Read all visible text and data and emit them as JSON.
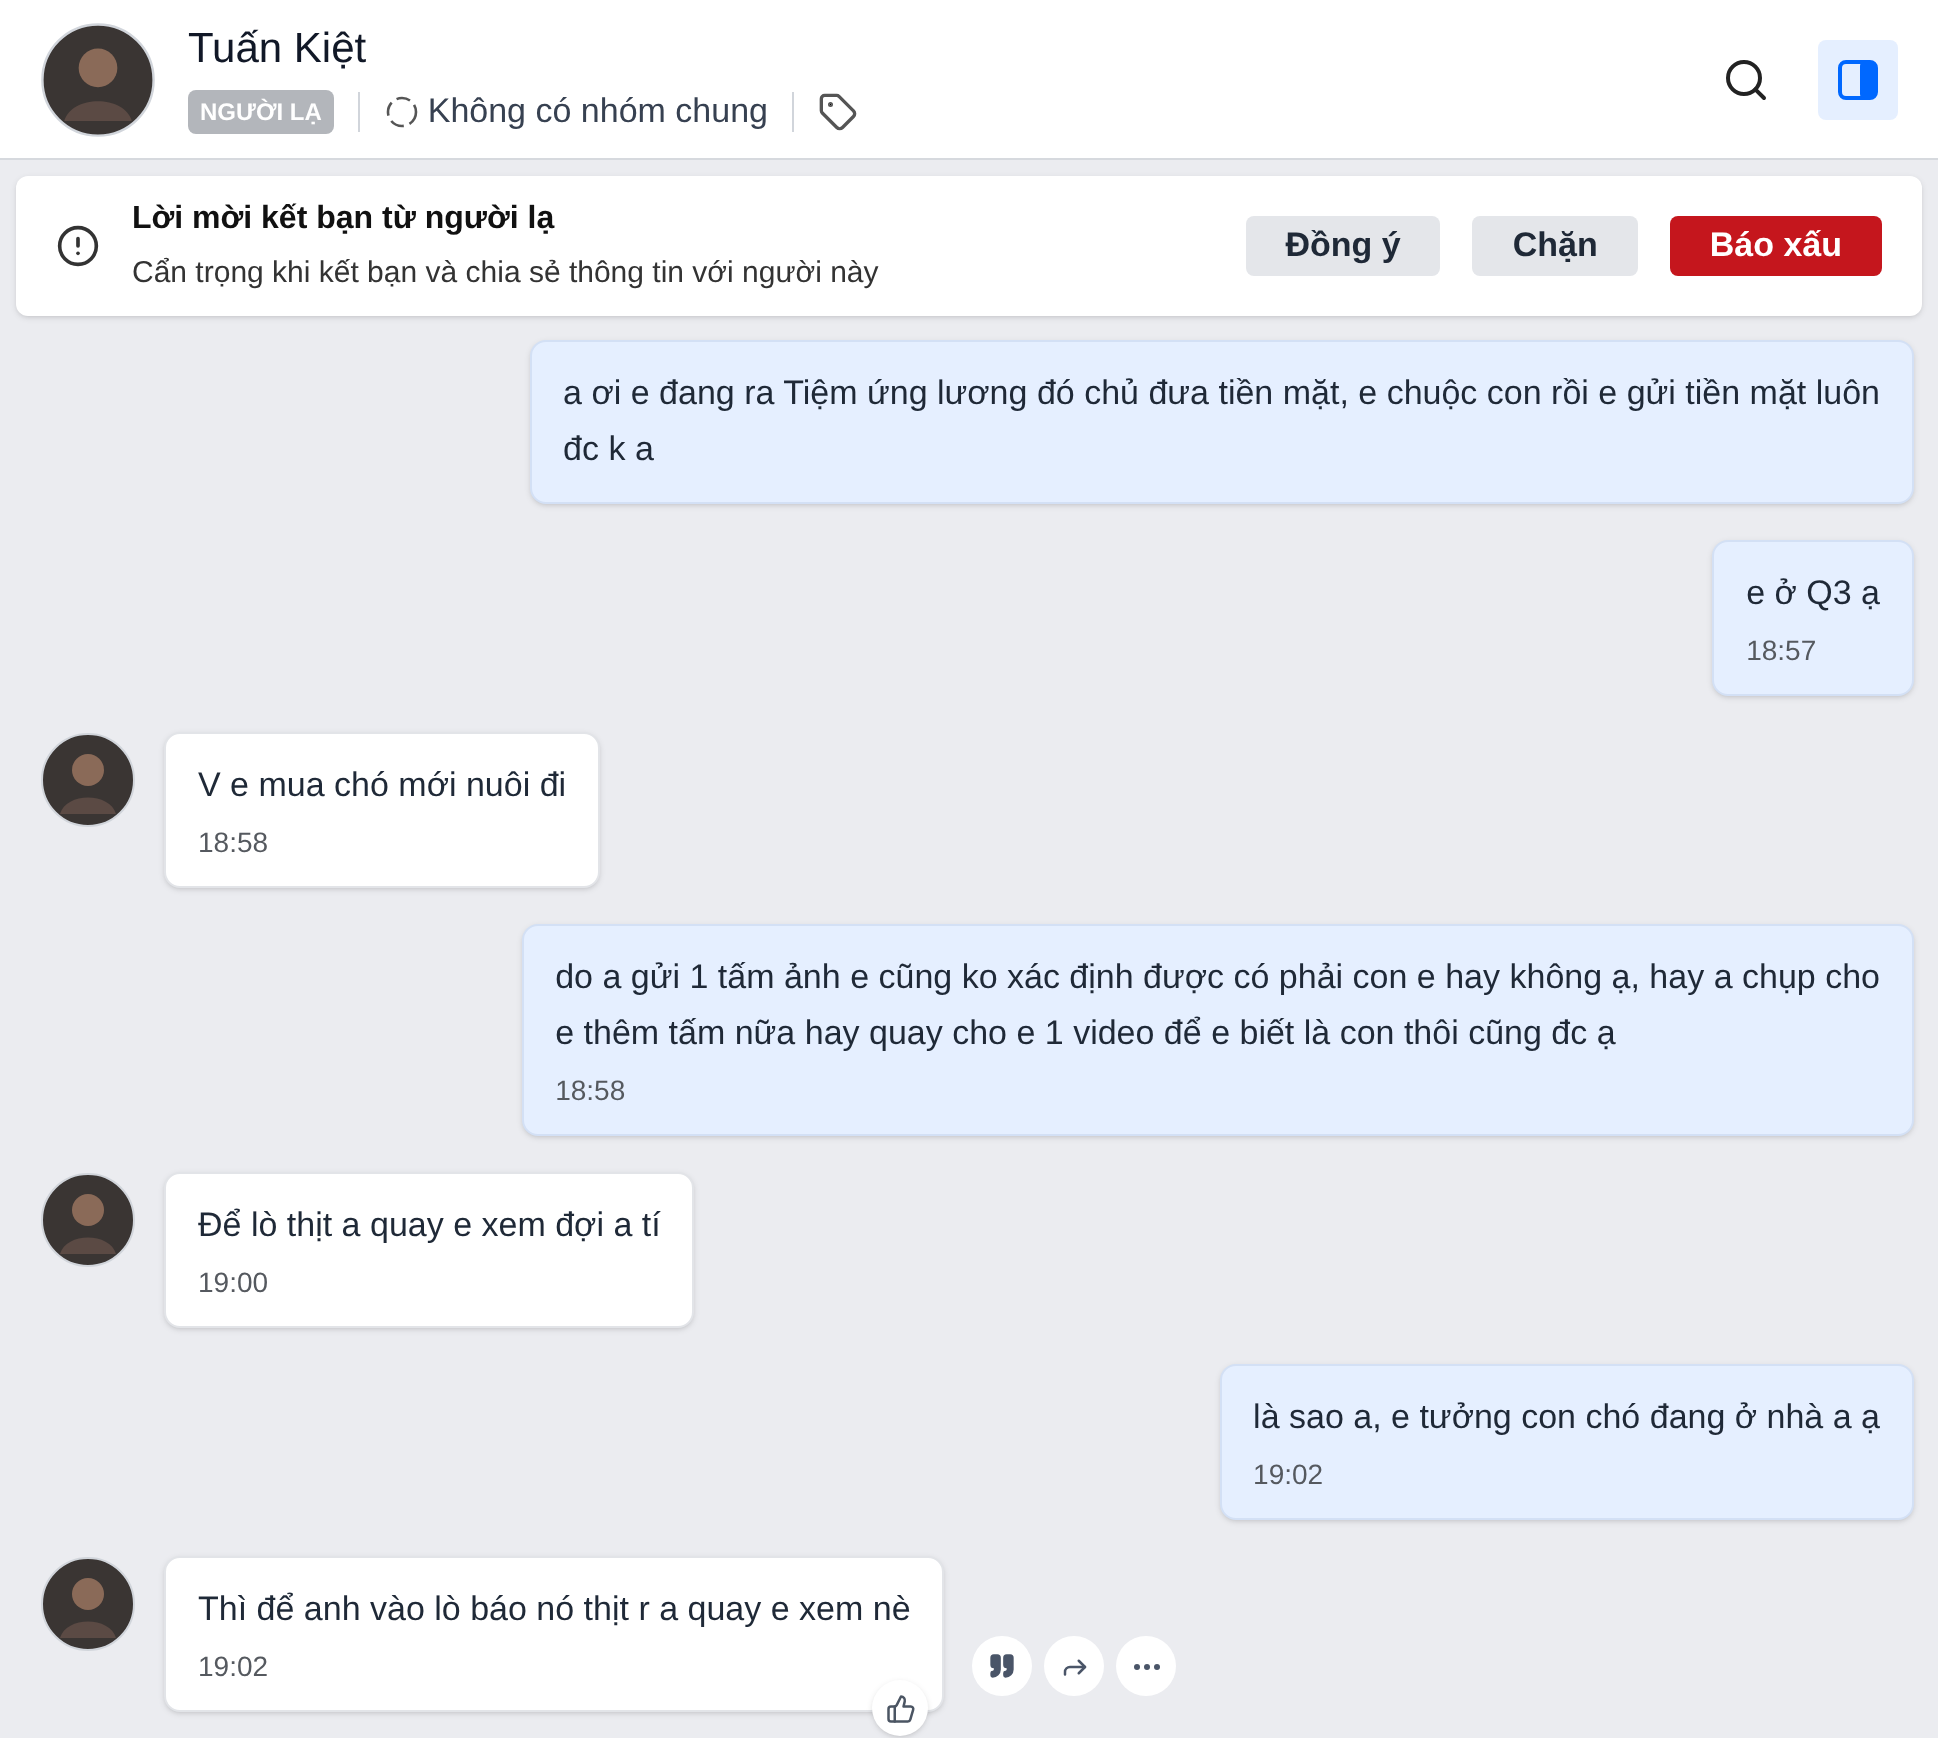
{
  "header": {
    "name": "Tuấn Kiệt",
    "badge": "NGƯỜI LẠ",
    "groups": "Không có nhóm chung",
    "panel_open": true
  },
  "banner": {
    "title": "Lời mời kết bạn từ người lạ",
    "subtitle": "Cẩn trọng khi kết bạn và chia sẻ thông tin với người này",
    "buttons": [
      {
        "label": "Đồng ý",
        "kind": "neutral"
      },
      {
        "label": "Chặn",
        "kind": "neutral"
      },
      {
        "label": "Báo xấu",
        "kind": "danger"
      }
    ]
  },
  "messages": [
    {
      "kind": "outgoing",
      "lines": [
        "a ơi e đang ra Tiệm ứng lương đó chủ đưa tiền mặt, e chuộc con rồi e gửi tiền mặt luôn",
        "đc k a"
      ]
    },
    {
      "kind": "outgoing",
      "lines": [
        "e ở Q3 ạ"
      ],
      "time": "18:57"
    },
    {
      "kind": "incoming",
      "lines": [
        "V e mua chó mới nuôi đi"
      ],
      "time": "18:58"
    },
    {
      "kind": "outgoing",
      "lines": [
        "do a gửi 1 tấm ảnh e cũng ko xác định được có phải con e hay không ạ, hay a chụp cho",
        "e thêm tấm nữa hay quay cho e 1 video để e biết là con thôi cũng đc ạ"
      ],
      "time": "18:58"
    },
    {
      "kind": "incoming",
      "lines": [
        "Để lò thịt a quay e xem đợi a tí"
      ],
      "time": "19:00"
    },
    {
      "kind": "outgoing",
      "lines": [
        "là sao a, e tưởng con chó đang ở nhà a ạ"
      ],
      "time": "19:02"
    },
    {
      "kind": "incoming",
      "lines": [
        "Thì để anh vào lò báo nó thịt r a quay e xem nè"
      ],
      "time": "19:02",
      "hovered": true
    }
  ]
}
